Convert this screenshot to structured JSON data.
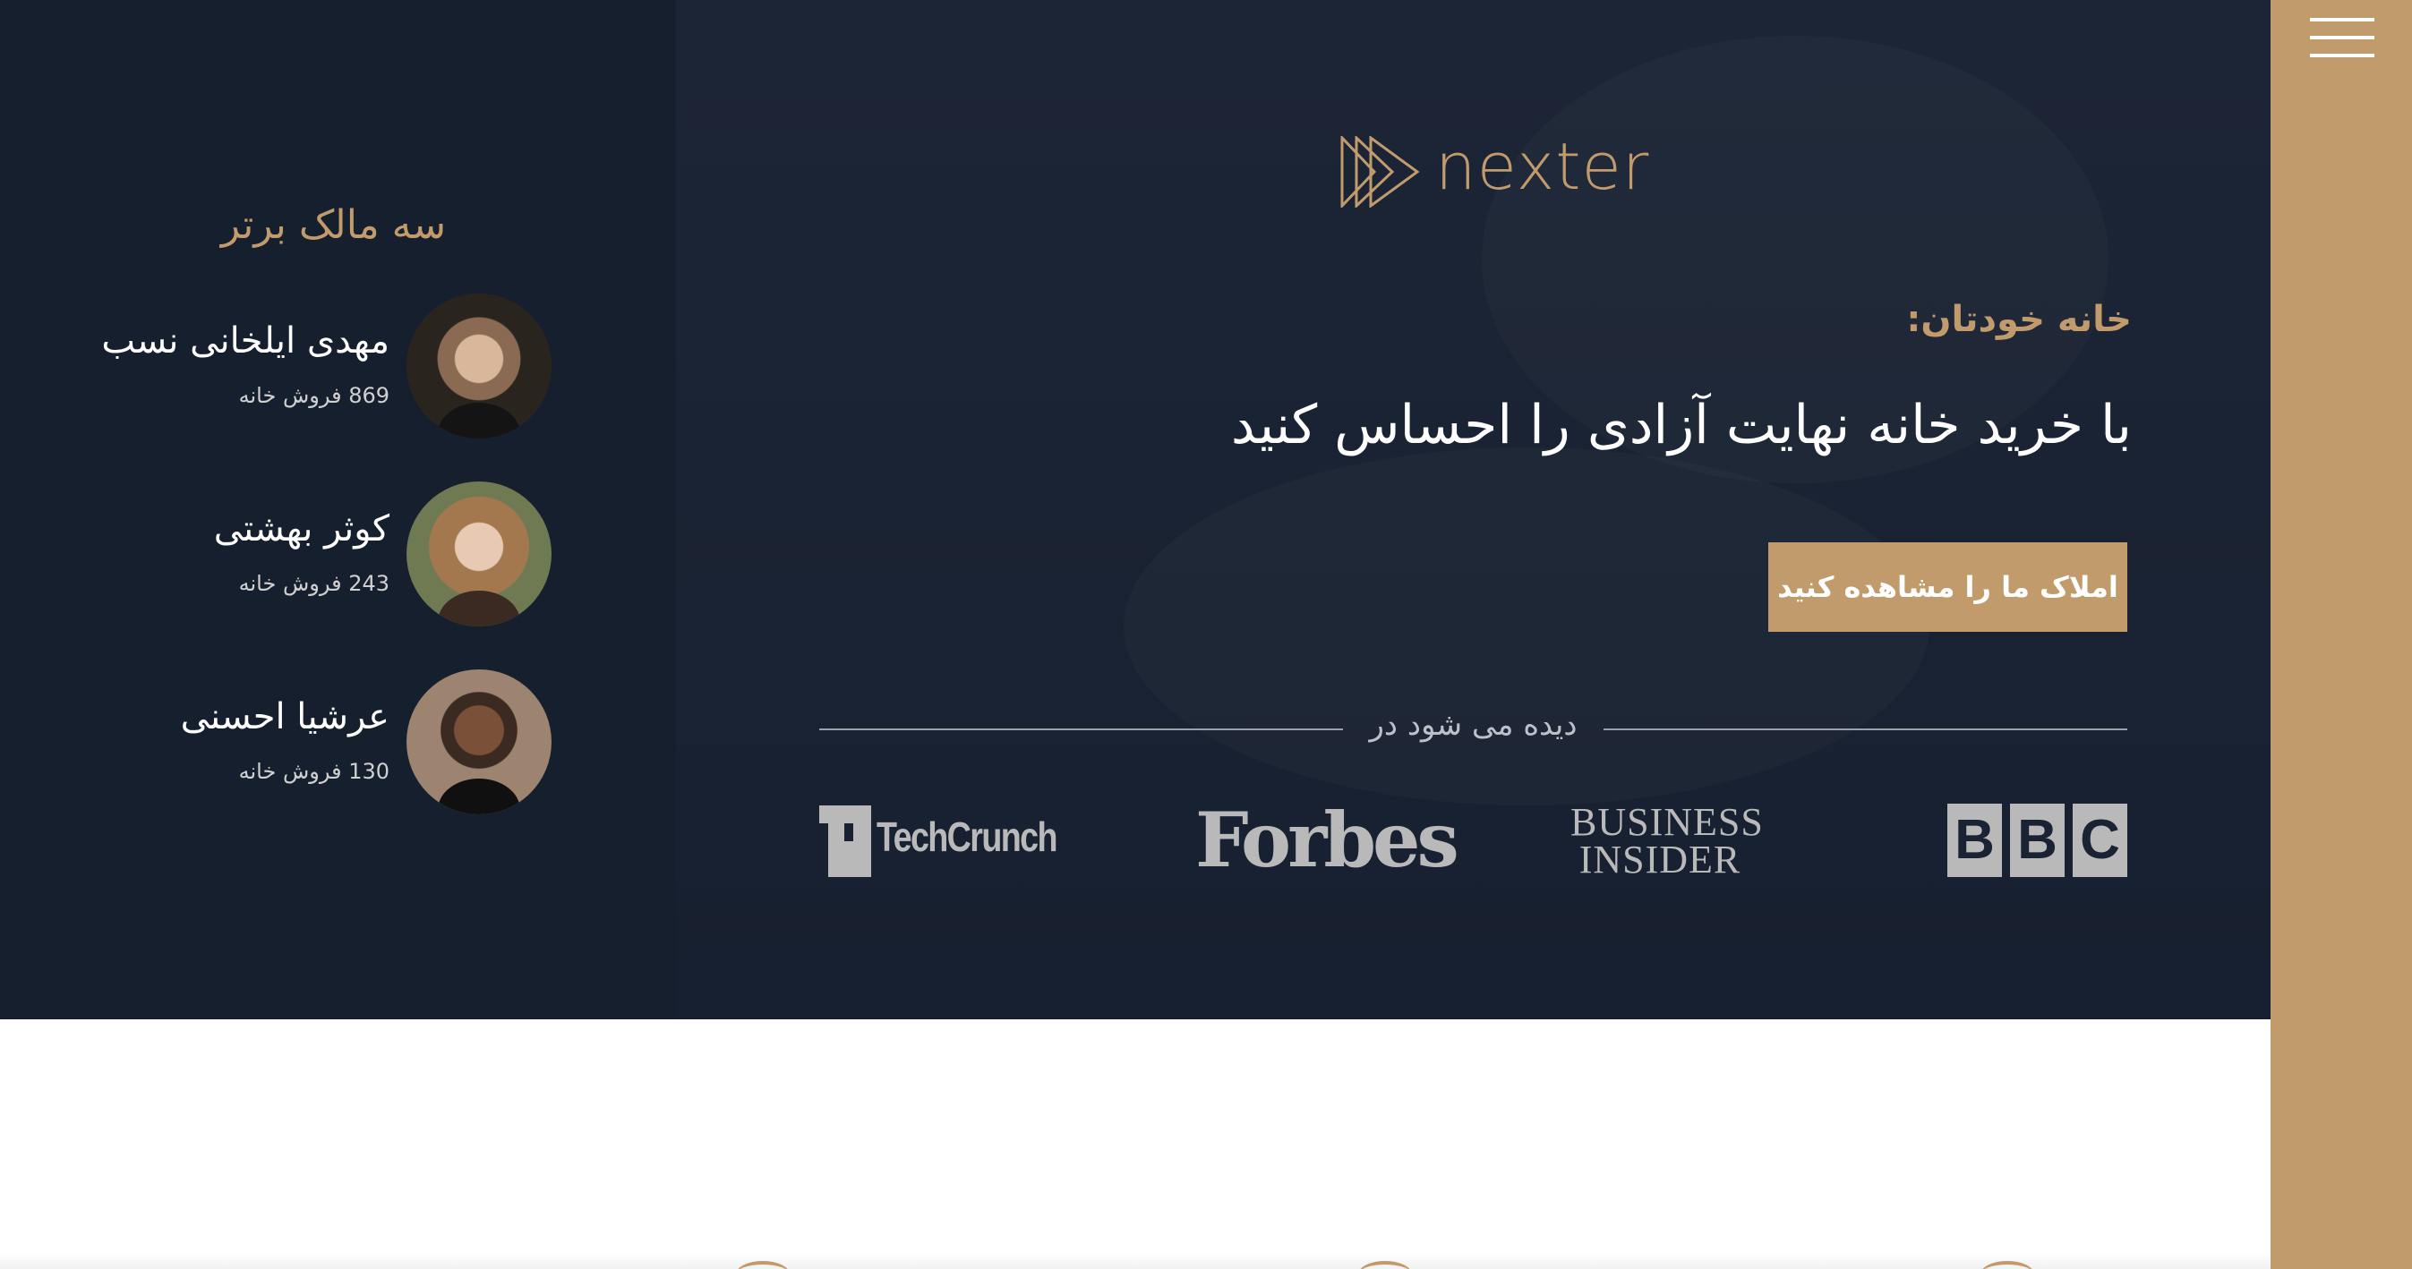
{
  "sidebar": {
    "menu_icon": "hamburger-menu-icon",
    "color": "#c19b6c"
  },
  "realtors": {
    "title": "سه مالک برتر",
    "items": [
      {
        "name": "مهدی ایلخانی نسب",
        "sold": "869 فروش خانه"
      },
      {
        "name": "کوثر بهشتی",
        "sold": "243 فروش خانه"
      },
      {
        "name": "عرشیا احسنی",
        "sold": "130 فروش خانه"
      }
    ]
  },
  "header": {
    "logo_text": "nexter",
    "subtitle": "خانه خودتان:",
    "heading": "با خرید خانه نهایت آزادی را احساس کنید",
    "cta_label": "املاک ما را مشاهده کنید",
    "seen_on_label": "دیده می شود در",
    "press": {
      "bbc": [
        "B",
        "B",
        "C"
      ],
      "business_insider": [
        "BUSINESS",
        "INSIDER"
      ],
      "forbes": "Forbes",
      "techcrunch": "TechCrunch"
    }
  },
  "colors": {
    "accent": "#c19b6c",
    "dark_panel": "#161f2d",
    "header_bg": "#1c2536"
  }
}
